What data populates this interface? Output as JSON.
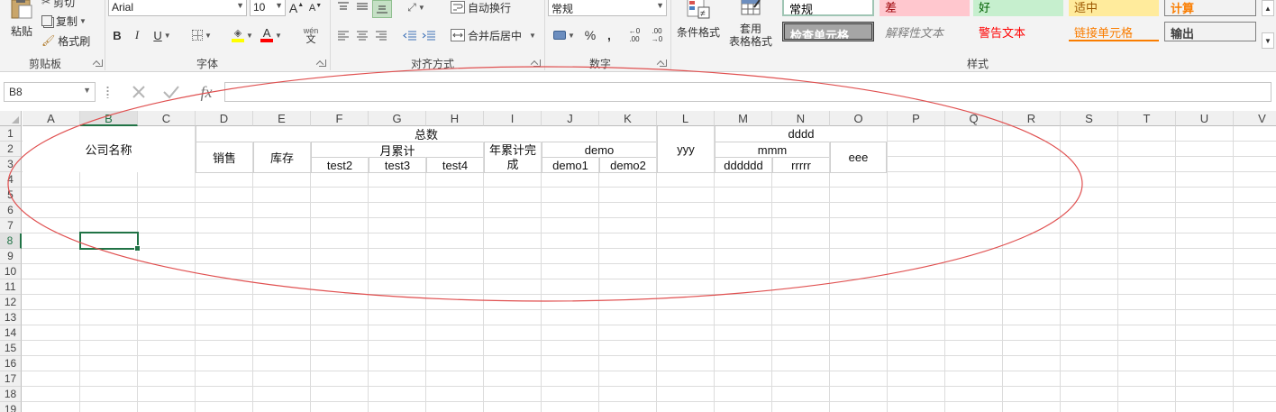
{
  "ribbon": {
    "clipboard": {
      "group_label": "剪贴板",
      "paste_label": "粘贴",
      "cut_label": "剪切",
      "copy_label": "复制",
      "format_painter_label": "格式刷"
    },
    "font": {
      "group_label": "字体",
      "font_name": "Arial",
      "font_size": "10",
      "bold": "B",
      "italic": "I",
      "underline": "U",
      "grow_font": "A",
      "shrink_font": "A",
      "phonetic": "wén",
      "phonetic_sub": "文"
    },
    "alignment": {
      "group_label": "对齐方式",
      "wrap_text_label": "自动换行",
      "merge_center_label": "合并后居中"
    },
    "number": {
      "group_label": "数字",
      "format_value": "常规",
      "percent": "%",
      "comma": ",",
      "increase_decimal_top": "←0",
      "increase_decimal_bottom": ".00",
      "decrease_decimal_top": ".00",
      "decrease_decimal_bottom": "→0"
    },
    "styles": {
      "group_label": "样式",
      "conditional_format_label": "条件格式",
      "format_as_table_label_1": "套用",
      "format_as_table_label_2": "表格格式",
      "gallery": [
        {
          "label": "常规",
          "bg": "#ffffff",
          "fg": "#000000"
        },
        {
          "label": "差",
          "bg": "#ffc7ce",
          "fg": "#9c0006"
        },
        {
          "label": "好",
          "bg": "#c6efce",
          "fg": "#006100"
        },
        {
          "label": "适中",
          "bg": "#ffeb9c",
          "fg": "#9c5700"
        },
        {
          "label": "计算",
          "bg": "#f2f2f2",
          "fg": "#fa7d00"
        },
        {
          "label": "检查单元格",
          "bg": "#a5a5a5",
          "fg": "#ffffff"
        },
        {
          "label": "解释性文本",
          "bg": "#f3f3f3",
          "fg": "#7f7f7f"
        },
        {
          "label": "警告文本",
          "bg": "#f3f3f3",
          "fg": "#ff0000"
        },
        {
          "label": "链接单元格",
          "bg": "#f3f3f3",
          "fg": "#fa7d00"
        },
        {
          "label": "输出",
          "bg": "#f2f2f2",
          "fg": "#3f3f3f"
        }
      ]
    }
  },
  "formula_bar": {
    "name_box": "B8",
    "fx_label": "fx",
    "formula_value": ""
  },
  "grid": {
    "columns": [
      "A",
      "B",
      "C",
      "D",
      "E",
      "F",
      "G",
      "H",
      "I",
      "J",
      "K",
      "L",
      "M",
      "N",
      "O",
      "P",
      "Q",
      "R",
      "S",
      "T",
      "U",
      "V"
    ],
    "rows": [
      "1",
      "2",
      "3",
      "4",
      "5",
      "6",
      "7",
      "8",
      "9",
      "10",
      "11",
      "12",
      "13",
      "14",
      "15",
      "16",
      "17",
      "18",
      "19"
    ],
    "active_column": "B",
    "active_row": "8",
    "cells": {
      "B1_merged": "公司名称",
      "D_sales": "销售",
      "E_stock": "库存",
      "F1_total": "总数",
      "F2_monthly": "月累计",
      "F3": "test2",
      "G3": "test3",
      "H3": "test4",
      "I2_yearly_line1": "年累计完",
      "I2_yearly_line2": "成",
      "J2_demo": "demo",
      "J3": "demo1",
      "K3": "demo2",
      "L_yyy": "yyy",
      "M1_dddd": "dddd",
      "M2_mmm": "mmm",
      "M3": "dddddd",
      "N3": "rrrrr",
      "O_eee": "eee"
    }
  },
  "annotation": {
    "shape": "ellipse",
    "color": "#e05050"
  }
}
